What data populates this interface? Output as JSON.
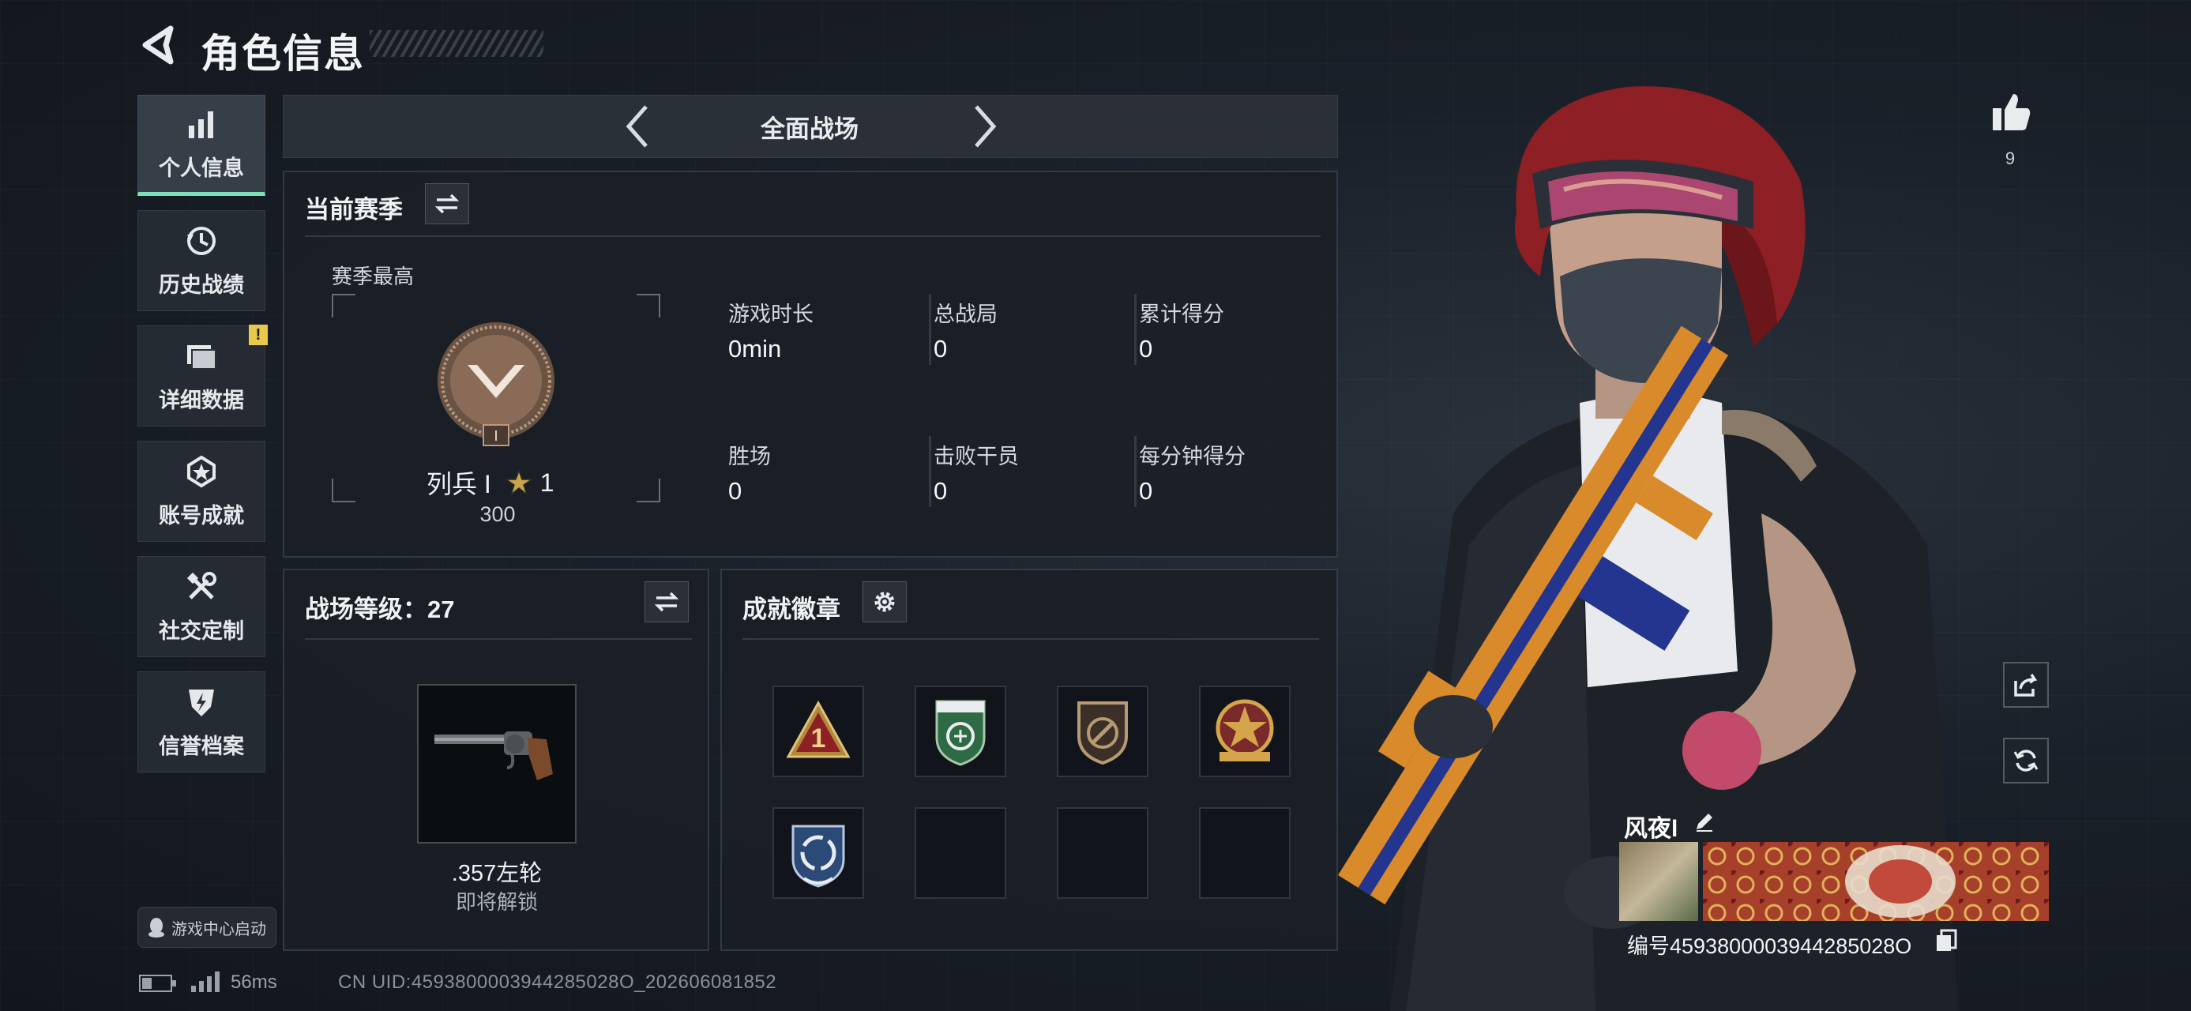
{
  "header": {
    "title": "角色信息"
  },
  "sidebar": {
    "items": [
      {
        "label": "个人信息",
        "icon": "bar-chart-icon",
        "active": true
      },
      {
        "label": "历史战绩",
        "icon": "history-clock-icon",
        "active": false
      },
      {
        "label": "详细数据",
        "icon": "folder-icon",
        "active": false,
        "badge": "!"
      },
      {
        "label": "账号成就",
        "icon": "achievement-medal-icon",
        "active": false
      },
      {
        "label": "社交定制",
        "icon": "tools-icon",
        "active": false
      },
      {
        "label": "信誉档案",
        "icon": "shield-lightning-icon",
        "active": false
      }
    ],
    "launch_label": "游戏中心启动"
  },
  "mode": {
    "title": "全面战场"
  },
  "season": {
    "title": "当前赛季",
    "best_label": "赛季最高",
    "rank_name": "列兵 I",
    "rank_stars": "1",
    "rank_points": "300",
    "stats": [
      {
        "label": "游戏时长",
        "value": "0min"
      },
      {
        "label": "总战局",
        "value": "0"
      },
      {
        "label": "累计得分",
        "value": "0"
      },
      {
        "label": "胜场",
        "value": "0"
      },
      {
        "label": "击败干员",
        "value": "0"
      },
      {
        "label": "每分钟得分",
        "value": "0"
      }
    ]
  },
  "battlefield": {
    "title": "战场等级：27",
    "weapon_name": ".357左轮",
    "weapon_status": "即将解锁"
  },
  "badges": {
    "title": "成就徽章",
    "slots": [
      {
        "icon": "rank-one-badge-icon",
        "filled": true
      },
      {
        "icon": "green-shield-badge-icon",
        "filled": true
      },
      {
        "icon": "bronze-shield-badge-icon",
        "filled": true
      },
      {
        "icon": "star-wreath-badge-icon",
        "filled": true
      },
      {
        "icon": "blue-cycle-badge-icon",
        "filled": true
      },
      {
        "icon": "empty-slot",
        "filled": false
      },
      {
        "icon": "empty-slot",
        "filled": false
      },
      {
        "icon": "empty-slot",
        "filled": false
      }
    ]
  },
  "profile": {
    "likes": "9",
    "nickname": "风夜l",
    "uid_line": "编号4593800003944285028O"
  },
  "status_bar": {
    "ping": "56ms",
    "uid": "CN UID:4593800003944285028O_202606081852"
  },
  "colors": {
    "accent_green": "#7ee0b8",
    "warning_yellow": "#e8c94a",
    "bronze": "#9a7a62",
    "hair_red": "#8e1f24",
    "gun_orange": "#d98a2b",
    "gun_blue": "#23358f"
  }
}
